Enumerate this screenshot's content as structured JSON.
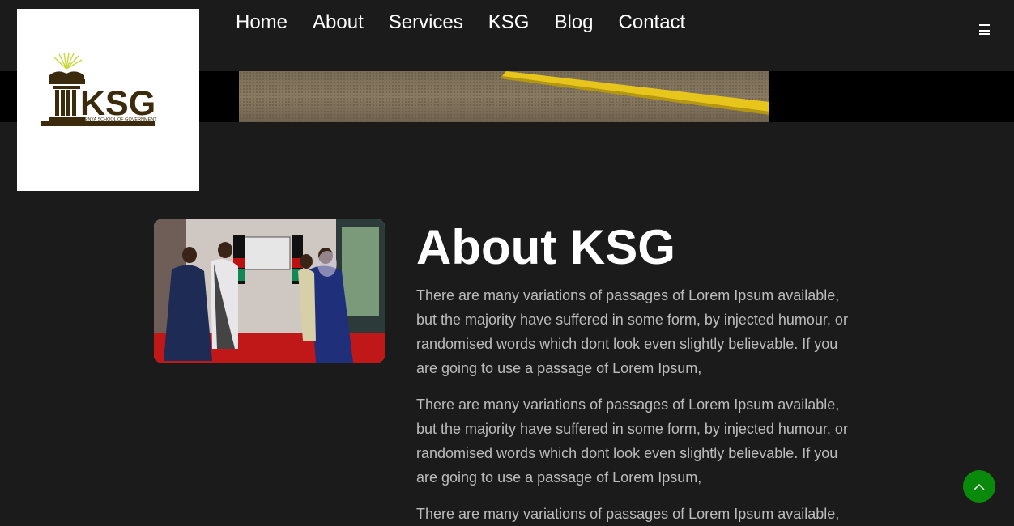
{
  "nav": {
    "items": [
      {
        "label": "Home"
      },
      {
        "label": "About"
      },
      {
        "label": "Services"
      },
      {
        "label": "KSG"
      },
      {
        "label": "Blog"
      },
      {
        "label": "Contact"
      }
    ],
    "menu_icon": "hamburger-menu-icon"
  },
  "logo": {
    "text": "KSG",
    "subtitle": "KENYA SCHOOL OF GOVERNMENT",
    "color": "#3b2a0c"
  },
  "about": {
    "title": "About KSG",
    "paragraphs": [
      "There are many variations of passages of Lorem Ipsum available, but the majority have suffered in some form, by injected humour, or randomised words which dont look even slightly believable. If you are going to use a passage of Lorem Ipsum,",
      "There are many variations of passages of Lorem Ipsum available, but the majority have suffered in some form, by injected humour, or randomised words which dont look even slightly believable. If you are going to use a passage of Lorem Ipsum,",
      "There are many variations of passages of Lorem Ipsum available,"
    ]
  },
  "back_to_top": {
    "icon": "chevron-up-icon",
    "color": "#0a8a0a"
  }
}
